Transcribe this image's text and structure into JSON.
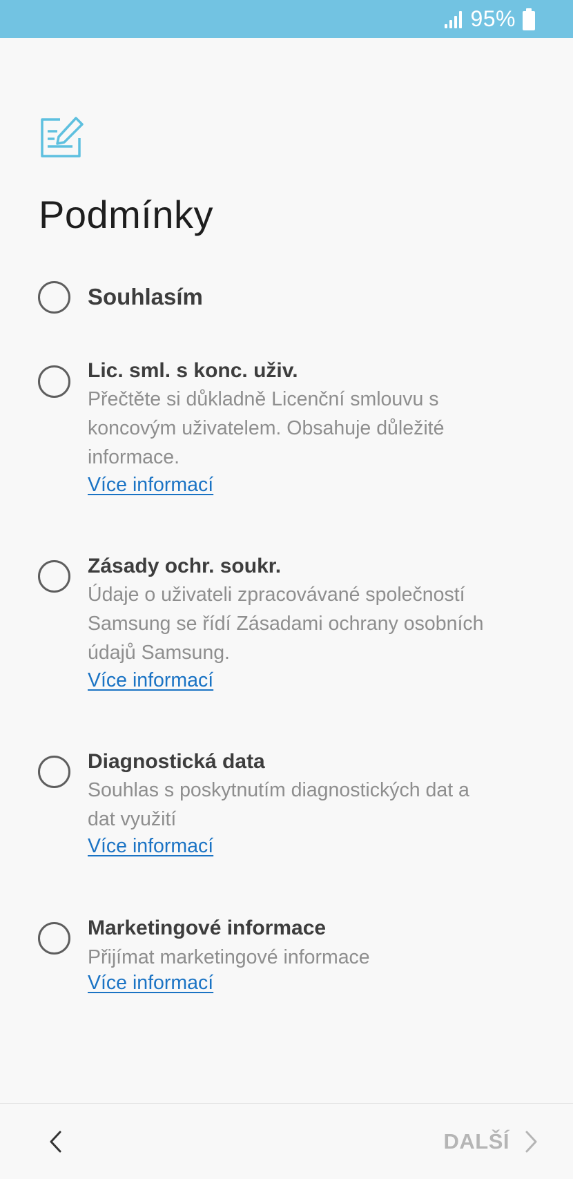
{
  "status_bar": {
    "battery_text": "95%",
    "signal_icon": "signal-icon",
    "battery_icon": "battery-icon",
    "background_color": "#72c3e2"
  },
  "header": {
    "icon": "terms-edit-icon",
    "title": "Podmínky"
  },
  "agree_all": {
    "label": "Souhlasím"
  },
  "options": [
    {
      "title": "Lic. sml. s konc. uživ.",
      "description": "Přečtěte si důkladně Licenční smlouvu s koncovým uživatelem. Obsahuje důležité informace.",
      "link": "Více informací"
    },
    {
      "title": "Zásady ochr. soukr.",
      "description": "Údaje o uživateli zpracovávané společností Samsung se řídí Zásadami ochrany osobních údajů Samsung.",
      "link": "Více informací"
    },
    {
      "title": "Diagnostická data",
      "description": "Souhlas s poskytnutím diagnostických dat a dat využití",
      "link": "Více informací"
    },
    {
      "title": "Marketingové informace",
      "description": "Přijímat marketingové informace",
      "link": "Více informací"
    }
  ],
  "footer": {
    "back_icon": "chevron-left-icon",
    "next_label": "DALŠÍ",
    "next_icon": "chevron-right-icon"
  },
  "colors": {
    "accent": "#72c3e2",
    "link": "#1a73c4",
    "disabled_text": "#b5b5b5"
  }
}
